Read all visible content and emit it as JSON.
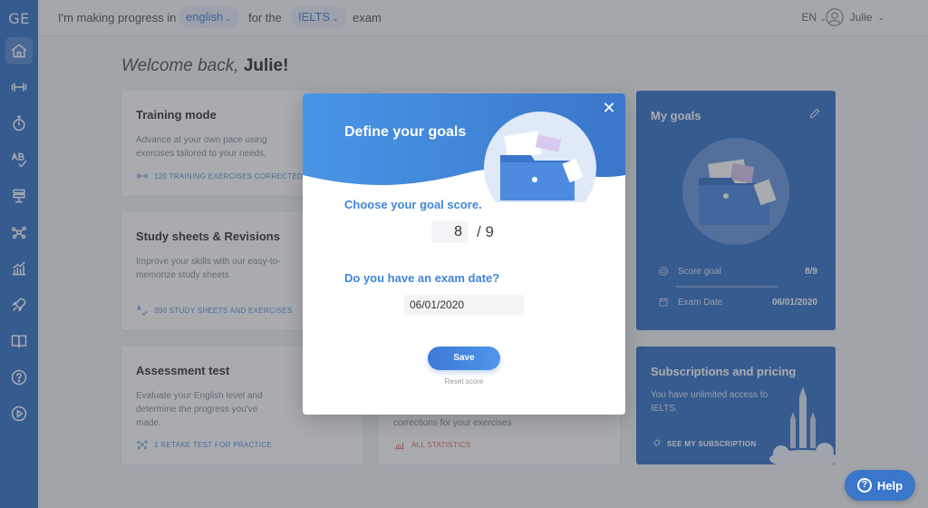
{
  "app": {
    "logo": "GE"
  },
  "topbar": {
    "prefix": "I'm making progress in",
    "language": "english",
    "for_text": "for the",
    "exam_type": "IELTS",
    "suffix": "exam",
    "locale": "EN",
    "user_name": "Julie"
  },
  "welcome": {
    "text": "Welcome back,",
    "name": "Julie!"
  },
  "cards": {
    "training": {
      "title": "Training mode",
      "desc": "Advance at your own pace using exercises tailored to your needs.",
      "link": "120 TRAINING EXERCISES CORRECTED"
    },
    "study": {
      "title": "Study sheets & Revisions",
      "desc": "Improve your skills with our easy-to-memorize study sheets",
      "link": "390 STUDY SHEETS AND EXERCISES"
    },
    "assessment": {
      "title": "Assessment test",
      "desc": "Evaluate your English level and determine the progress you've made.",
      "link": "1 RETAKE TEST FOR PRACTICE"
    },
    "stats": {
      "desc": "corrections for your exercises",
      "link": "ALL STATISTICS"
    }
  },
  "goals_card": {
    "title": "My goals",
    "score_label": "Score goal",
    "score_value": "8/9",
    "date_label": "Exam Date",
    "date_value": "06/01/2020"
  },
  "subs_card": {
    "title": "Subscriptions and pricing",
    "desc": "You have unlimited access to IELTS.",
    "link": "SEE MY SUBSCRIPTION"
  },
  "modal": {
    "title": "Define your goals",
    "close": "✕",
    "goal_question": "Choose your goal score.",
    "score_value": "8",
    "score_max": "/ 9",
    "date_question": "Do you have an exam date?",
    "date_value": "06/01/2020",
    "save_label": "Save",
    "reset_label": "Reset score"
  },
  "help": {
    "label": "Help"
  },
  "colors": {
    "brand": "#3a76c9",
    "accent": "#4a86d8",
    "link_red": "#e0715f"
  },
  "icons": [
    "home-icon",
    "dumbbell-icon",
    "timer-icon",
    "spelling-icon",
    "stack-icon",
    "network-icon",
    "stats-icon",
    "rocket-icon",
    "book-icon",
    "question-icon",
    "play-icon"
  ]
}
